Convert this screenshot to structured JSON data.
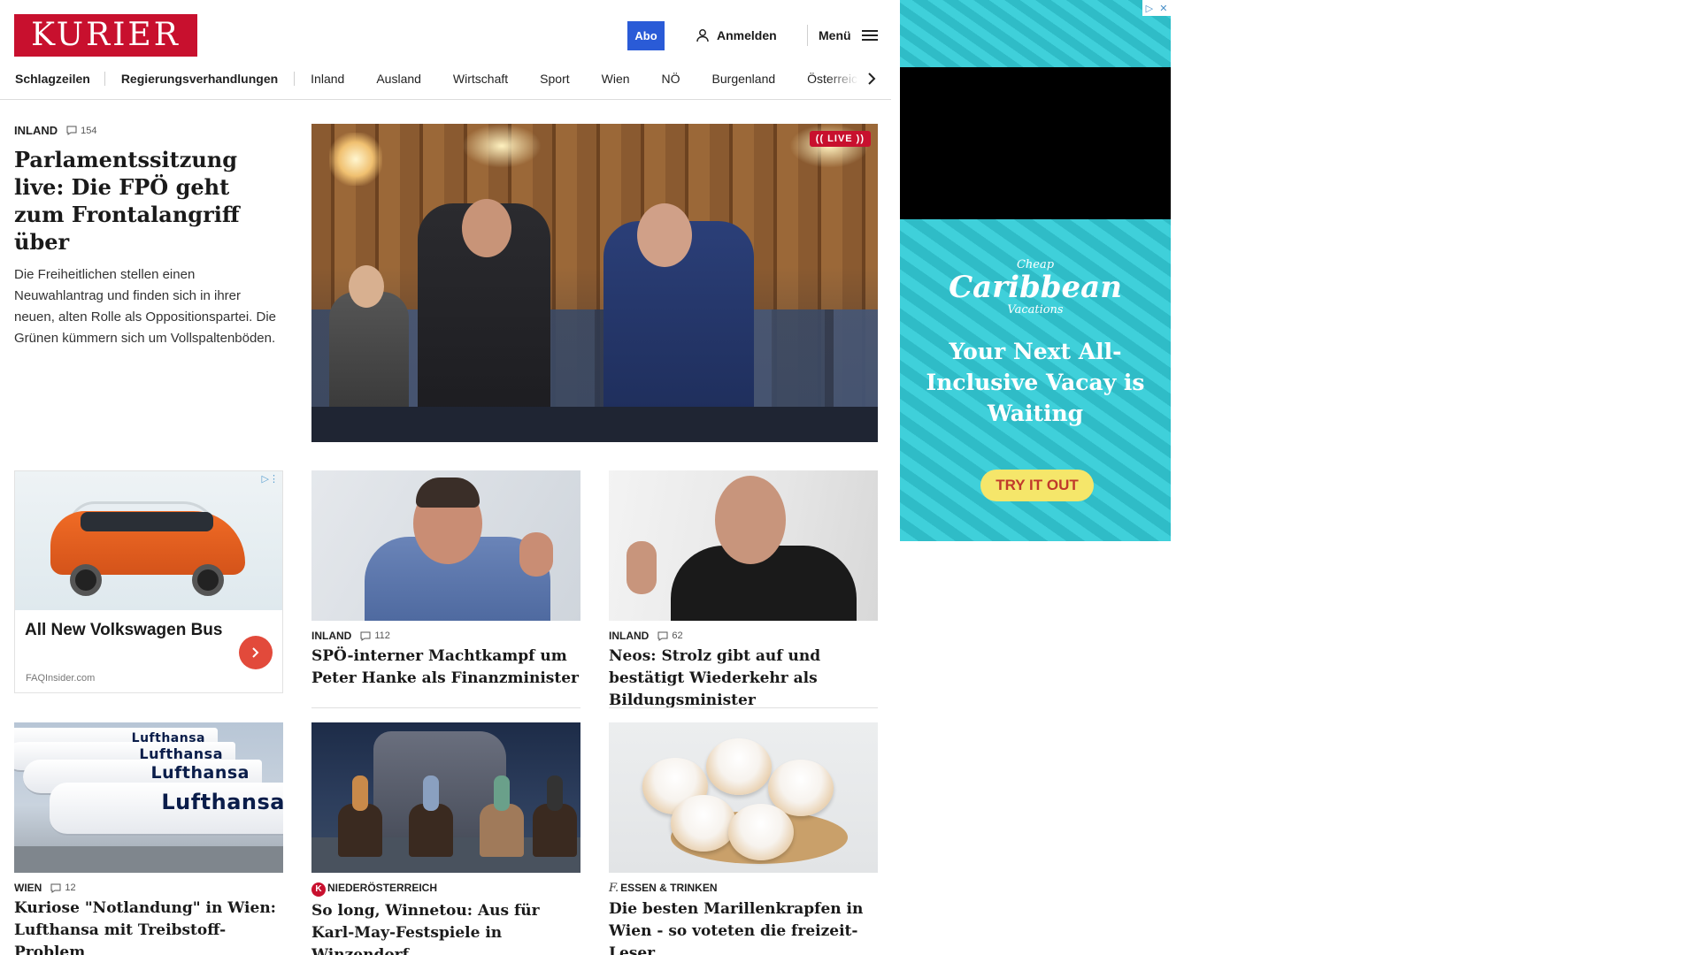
{
  "header": {
    "logo_text": "KURIER",
    "abo_label": "Abo",
    "login_label": "Anmelden",
    "menu_label": "Menü"
  },
  "nav": {
    "items": [
      "Schlagzeilen",
      "Regierungsverhandlungen",
      "Inland",
      "Ausland",
      "Wirtschaft",
      "Sport",
      "Wien",
      "NÖ",
      "Burgenland",
      "Österreich"
    ]
  },
  "lead": {
    "category": "INLAND",
    "comments": "154",
    "title": "Parlamentssitzung live: Die FPÖ geht zum Frontalangriff über",
    "teaser": "Die Freiheitlichen stellen einen Neuwahlantrag und finden sich in ihrer neuen, alten Rolle als Oppositionspartei. Die Grünen kümmern sich um Vollspaltenböden.",
    "live_label": "(( LIVE ))"
  },
  "sponsored": {
    "title": "All New Volkswagen Bus",
    "source": "FAQInsider.com"
  },
  "stories": [
    {
      "category": "INLAND",
      "comments": "112",
      "title": "SPÖ-interner Machtkampf um Peter Hanke als Finanzminister"
    },
    {
      "category": "INLAND",
      "comments": "62",
      "title": "Neos: Strolz gibt auf und bestätigt Wiederkehr als Bildungsminister"
    },
    {
      "category": "WIEN",
      "comments": "12",
      "title": "Kuriose \"Notlandung\" in Wien: Lufthansa mit Treibstoff-Problem"
    },
    {
      "category": "NIEDERÖSTERREICH",
      "title": "So long, Winnetou: Aus für Karl-May-Festspiele in Winzendorf"
    },
    {
      "category": "ESSEN & TRINKEN",
      "title": "Die besten Marillenkrapfen in Wien - so voteten die freizeit-Leser"
    }
  ],
  "lufthansa_text": "Lufthansa",
  "banner": {
    "brand_small": "Cheap",
    "brand_big": "Caribbean",
    "brand_sub": "Vacations",
    "headline": "Your Next All-Inclusive Vacay is Waiting",
    "cta": "TRY IT OUT"
  },
  "colors": {
    "brand": "#c8102e",
    "abo": "#2a5bd7",
    "banner": "#32c4cf"
  }
}
